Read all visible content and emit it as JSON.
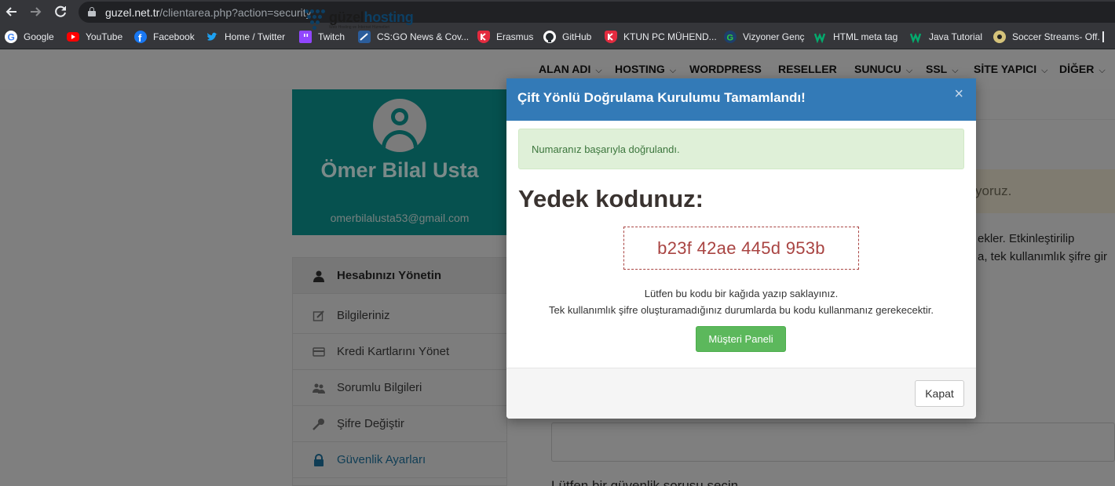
{
  "browser": {
    "url_host": "guzel.net.tr",
    "url_path": "/clientarea.php?action=security",
    "bookmarks": [
      {
        "label": "Google",
        "icon": "google-icon",
        "color": "#ffffff"
      },
      {
        "label": "YouTube",
        "icon": "youtube-icon",
        "color": "#ff0000"
      },
      {
        "label": "Facebook",
        "icon": "facebook-icon",
        "color": "#1877f2"
      },
      {
        "label": "Home / Twitter",
        "icon": "twitter-icon",
        "color": "#1da1f2"
      },
      {
        "label": "Twitch",
        "icon": "twitch-icon",
        "color": "#9146ff"
      },
      {
        "label": "CS:GO News & Cov...",
        "icon": "hltv-icon",
        "color": "#2b5d9b"
      },
      {
        "label": "Erasmus",
        "icon": "erasmus-icon",
        "color": "#e32b3f"
      },
      {
        "label": "GitHub",
        "icon": "github-icon",
        "color": "#ffffff"
      },
      {
        "label": "KTUN PC MÜHEND...",
        "icon": "ktun-icon",
        "color": "#e32b3f"
      },
      {
        "label": "Vizyoner Genç",
        "icon": "vizyoner-icon",
        "color": "#2e9c3c"
      },
      {
        "label": "HTML meta tag",
        "icon": "w3-icon",
        "color": "#04aa6d"
      },
      {
        "label": "Java Tutorial",
        "icon": "w3-icon",
        "color": "#04aa6d"
      },
      {
        "label": "Soccer Streams- Off...",
        "icon": "soccer-ball-icon",
        "color": "#d4c27a"
      }
    ]
  },
  "site": {
    "logo_main": "güzel",
    "logo_bold": "hosting",
    "logo_tagline": "Web Hosting ve İnternet Hizmetleri",
    "nav": [
      {
        "label": "ALAN ADI",
        "dropdown": true
      },
      {
        "label": "HOSTING",
        "dropdown": true
      },
      {
        "label": "WORDPRESS",
        "dropdown": false
      },
      {
        "label": "RESELLER",
        "dropdown": false
      },
      {
        "label": "SUNUCU",
        "dropdown": true
      },
      {
        "label": "SSL",
        "dropdown": true
      },
      {
        "label": "SİTE YAPICI",
        "dropdown": true
      },
      {
        "label": "DİĞER",
        "dropdown": true
      }
    ]
  },
  "profile": {
    "name": "Ömer Bilal Usta",
    "email": "omerbilalusta53@gmail.com"
  },
  "sidebar": {
    "header": "Hesabınızı Yönetin",
    "items": [
      {
        "label": "Bilgileriniz",
        "icon": "edit-icon"
      },
      {
        "label": "Kredi Kartlarını Yönet",
        "icon": "credit-card-icon"
      },
      {
        "label": "Sorumlu Bilgileri",
        "icon": "users-icon"
      },
      {
        "label": "Şifre Değiştir",
        "icon": "key-icon"
      },
      {
        "label": "Güvenlik Ayarları",
        "icon": "lock-icon",
        "active": true
      }
    ]
  },
  "background": {
    "alert_fragment": "yoruz.",
    "text_line1": "ekler. Etkinleştirilip",
    "text_line2": "a, tek kullanımlık şifre gir",
    "text_line3": "Lütfen bir güvenlik sorusu seçin"
  },
  "modal": {
    "title": "Çift Yönlü Doğrulama Kurulumu Tamamlandı!",
    "close_symbol": "×",
    "success_message": "Numaranız başarıyla doğrulandı.",
    "backup_heading": "Yedek kodunuz:",
    "backup_code": "b23f 42ae 445d 953b",
    "instruction_1": "Lütfen bu kodu bir kağıda yazıp saklayınız.",
    "instruction_2": "Tek kullanımlık şifre oluşturamadığınız durumlarda bu kodu kullanmanız gerekecektir.",
    "client_panel_button": "Müşteri Paneli",
    "close_button": "Kapat"
  },
  "colors": {
    "modal_header": "#337ab7",
    "success_bg": "#dff0d8",
    "success_text": "#3c763d",
    "backup_code": "#a94442",
    "primary_button": "#5cb85c"
  }
}
